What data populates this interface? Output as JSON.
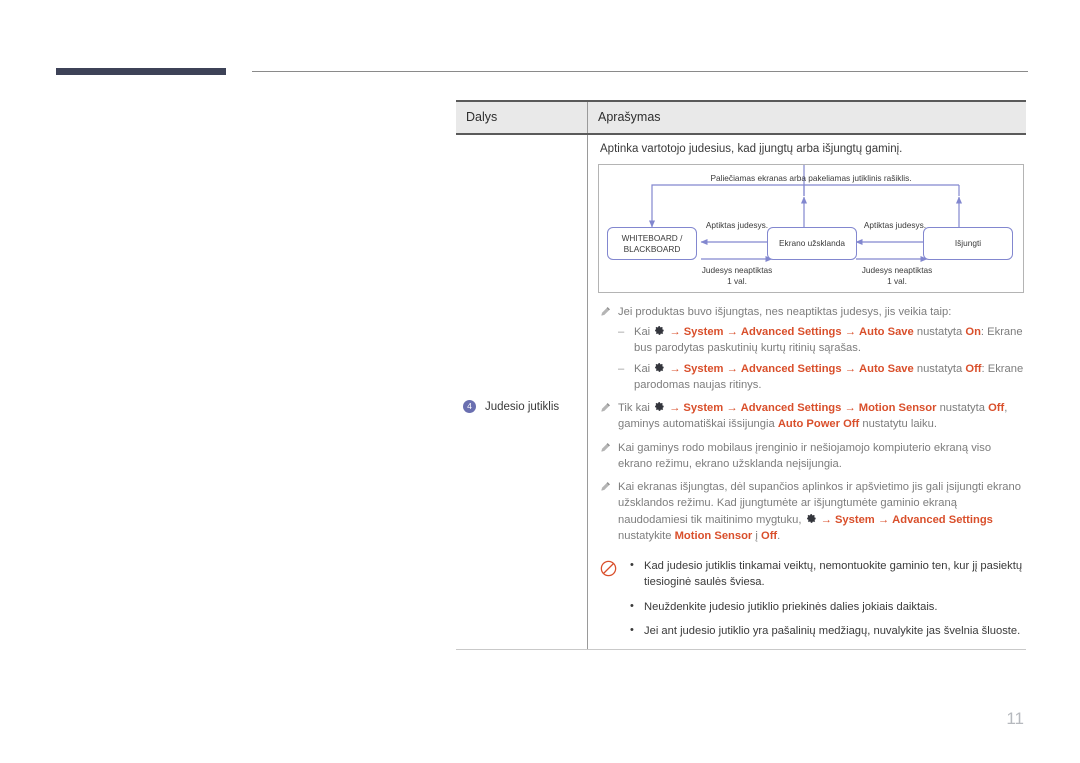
{
  "page": {
    "number": "11",
    "accent_bar_color": "#3d4257",
    "rule_color": "#8a8a8a",
    "page_number_color": "#b6b9be"
  },
  "table": {
    "headers": {
      "parts": "Dalys",
      "description": "Aprašymas"
    },
    "header_bg": "#e9e9e9",
    "row": {
      "part_number": "4",
      "part_badge_color": "#6a6fb0",
      "part_label": "Judesio jutiklis",
      "intro": "Aptinka vartotojo judesius, kad įjungtų arba išjungtų gaminį."
    }
  },
  "diagram": {
    "type": "state-flow",
    "border_color": "#b4b4b4",
    "line_color": "#8287cf",
    "top_label": "Paliečiamas ekranas arba pakeliamas jutiklinis rašiklis.",
    "boxes": [
      {
        "id": "whiteboard",
        "label": "WHITEBOARD /\nBLACKBOARD"
      },
      {
        "id": "screensaver",
        "label": "Ekrano užsklanda"
      },
      {
        "id": "off",
        "label": "Išjungti"
      }
    ],
    "transitions": [
      {
        "id": "motion-detected-left",
        "label": "Aptiktas judesys."
      },
      {
        "id": "motion-detected-right",
        "label": "Aptiktas judesys."
      },
      {
        "id": "no-motion-left",
        "label": "Judesys neaptiktas\n1 val."
      },
      {
        "id": "no-motion-right",
        "label": "Judesys neaptiktas\n1 val."
      }
    ]
  },
  "notes": [
    {
      "id": "note-power-off-behavior",
      "icon": "pencil-icon",
      "lead": "Jei produktas buvo išjungtas, nes neaptiktas judesys, jis veikia taip:",
      "subs": [
        {
          "id": "sub-auto-save-on",
          "parts": [
            {
              "t": "Kai ",
              "s": "gray"
            },
            {
              "t": "gear-icon",
              "s": "icon"
            },
            {
              "t": " → ",
              "s": "arrow"
            },
            {
              "t": "System",
              "s": "red"
            },
            {
              "t": " → ",
              "s": "arrow"
            },
            {
              "t": "Advanced Settings",
              "s": "red"
            },
            {
              "t": " → ",
              "s": "arrow"
            },
            {
              "t": "Auto Save",
              "s": "red"
            },
            {
              "t": " nustatyta ",
              "s": "gray"
            },
            {
              "t": "On",
              "s": "red"
            },
            {
              "t": ": Ekrane bus parodytas paskutinių kurtų ritinių sąrašas.",
              "s": "gray"
            }
          ]
        },
        {
          "id": "sub-auto-save-off",
          "parts": [
            {
              "t": "Kai ",
              "s": "gray"
            },
            {
              "t": "gear-icon",
              "s": "icon"
            },
            {
              "t": " → ",
              "s": "arrow"
            },
            {
              "t": "System",
              "s": "red"
            },
            {
              "t": " → ",
              "s": "arrow"
            },
            {
              "t": "Advanced Settings",
              "s": "red"
            },
            {
              "t": " → ",
              "s": "arrow"
            },
            {
              "t": "Auto Save",
              "s": "red"
            },
            {
              "t": " nustatyta ",
              "s": "gray"
            },
            {
              "t": "Off",
              "s": "red"
            },
            {
              "t": ": Ekrane parodomas naujas ritinys.",
              "s": "gray"
            }
          ]
        }
      ]
    },
    {
      "id": "note-motion-sensor-off",
      "icon": "pencil-icon",
      "parts": [
        {
          "t": "Tik kai ",
          "s": "gray"
        },
        {
          "t": "gear-icon",
          "s": "icon"
        },
        {
          "t": " → ",
          "s": "arrow"
        },
        {
          "t": "System",
          "s": "red"
        },
        {
          "t": " → ",
          "s": "arrow"
        },
        {
          "t": "Advanced Settings",
          "s": "red"
        },
        {
          "t": " → ",
          "s": "arrow"
        },
        {
          "t": "Motion Sensor",
          "s": "red"
        },
        {
          "t": " nustatyta ",
          "s": "gray"
        },
        {
          "t": "Off",
          "s": "red"
        },
        {
          "t": ", gaminys automatiškai išsijungia ",
          "s": "gray"
        },
        {
          "t": "Auto Power Off",
          "s": "red"
        },
        {
          "t": " nustatytu laiku.",
          "s": "gray"
        }
      ]
    },
    {
      "id": "note-fullscreen-mirroring",
      "icon": "pencil-icon",
      "parts": [
        {
          "t": "Kai gaminys rodo mobilaus įrenginio ir nešiojamojo kompiuterio ekraną viso ekrano režimu, ekrano užsklanda neįsijungia.",
          "s": "gray"
        }
      ]
    },
    {
      "id": "note-ambient-light",
      "icon": "pencil-icon",
      "parts": [
        {
          "t": "Kai ekranas išjungtas, dėl supančios aplinkos ir apšvietimo jis gali įsijungti ekrano užsklandos režimu. Kad įjungtumėte ar išjungtumėte gaminio ekraną naudodamiesi tik maitinimo mygtuku, ",
          "s": "gray"
        },
        {
          "t": "gear-icon",
          "s": "icon"
        },
        {
          "t": " → ",
          "s": "arrow"
        },
        {
          "t": "System",
          "s": "red"
        },
        {
          "t": " → ",
          "s": "arrow"
        },
        {
          "t": "Advanced Settings",
          "s": "red"
        },
        {
          "t": " nustatykite ",
          "s": "gray"
        },
        {
          "t": "Motion Sensor",
          "s": "red"
        },
        {
          "t": " į ",
          "s": "gray"
        },
        {
          "t": "Off",
          "s": "red"
        },
        {
          "t": ".",
          "s": "gray"
        }
      ]
    }
  ],
  "caution": {
    "icon": "prohibition-icon",
    "icon_color": "#d94f2b",
    "items": [
      "Kad judesio jutiklis tinkamai veiktų, nemontuokite gaminio ten, kur jį pasiektų tiesioginė saulės šviesa.",
      "Neuždenkite judesio jutiklio priekinės dalies jokiais daiktais.",
      "Jei ant judesio jutiklio yra pašalinių medžiagų, nuvalykite jas švelnia šluoste."
    ]
  }
}
